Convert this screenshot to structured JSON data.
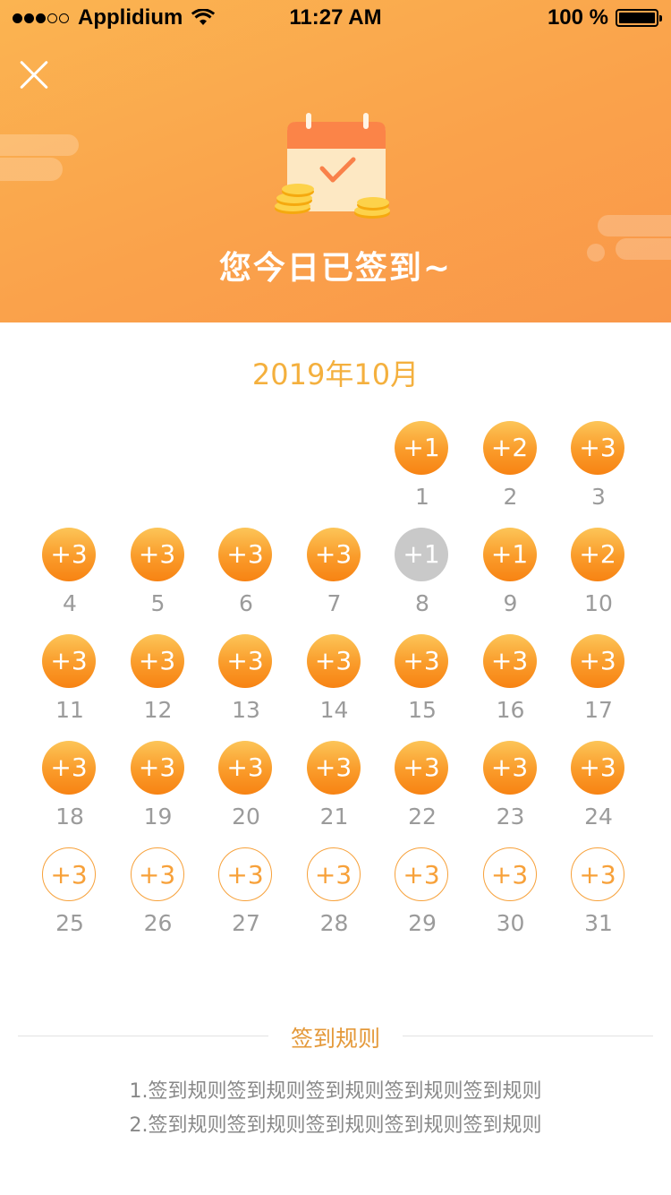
{
  "status_bar": {
    "carrier": "Applidium",
    "time": "11:27 AM",
    "battery": "100 %"
  },
  "header": {
    "title": "您今日已签到~"
  },
  "calendar": {
    "month": "2019年10月",
    "offset": 4,
    "days": [
      {
        "day": "1",
        "reward": "+1",
        "state": "signed"
      },
      {
        "day": "2",
        "reward": "+2",
        "state": "signed"
      },
      {
        "day": "3",
        "reward": "+3",
        "state": "signed"
      },
      {
        "day": "4",
        "reward": "+3",
        "state": "signed"
      },
      {
        "day": "5",
        "reward": "+3",
        "state": "signed"
      },
      {
        "day": "6",
        "reward": "+3",
        "state": "signed"
      },
      {
        "day": "7",
        "reward": "+3",
        "state": "signed"
      },
      {
        "day": "8",
        "reward": "+1",
        "state": "missed"
      },
      {
        "day": "9",
        "reward": "+1",
        "state": "signed"
      },
      {
        "day": "10",
        "reward": "+2",
        "state": "signed"
      },
      {
        "day": "11",
        "reward": "+3",
        "state": "signed"
      },
      {
        "day": "12",
        "reward": "+3",
        "state": "signed"
      },
      {
        "day": "13",
        "reward": "+3",
        "state": "signed"
      },
      {
        "day": "14",
        "reward": "+3",
        "state": "signed"
      },
      {
        "day": "15",
        "reward": "+3",
        "state": "signed"
      },
      {
        "day": "16",
        "reward": "+3",
        "state": "signed"
      },
      {
        "day": "17",
        "reward": "+3",
        "state": "signed"
      },
      {
        "day": "18",
        "reward": "+3",
        "state": "signed"
      },
      {
        "day": "19",
        "reward": "+3",
        "state": "signed"
      },
      {
        "day": "20",
        "reward": "+3",
        "state": "signed"
      },
      {
        "day": "21",
        "reward": "+3",
        "state": "signed"
      },
      {
        "day": "22",
        "reward": "+3",
        "state": "signed"
      },
      {
        "day": "23",
        "reward": "+3",
        "state": "signed"
      },
      {
        "day": "24",
        "reward": "+3",
        "state": "signed"
      },
      {
        "day": "25",
        "reward": "+3",
        "state": "upcoming"
      },
      {
        "day": "26",
        "reward": "+3",
        "state": "upcoming"
      },
      {
        "day": "27",
        "reward": "+3",
        "state": "upcoming"
      },
      {
        "day": "28",
        "reward": "+3",
        "state": "upcoming"
      },
      {
        "day": "29",
        "reward": "+3",
        "state": "upcoming"
      },
      {
        "day": "30",
        "reward": "+3",
        "state": "upcoming"
      },
      {
        "day": "31",
        "reward": "+3",
        "state": "upcoming"
      }
    ]
  },
  "rules": {
    "title": "签到规则",
    "lines": [
      "1.签到规则签到规则签到规则签到规则签到规则",
      "2.签到规则签到规则签到规则签到规则签到规则"
    ]
  },
  "colors": {
    "header_top": "#fbb451",
    "header_bottom": "#f9974a",
    "accent": "#f4b03e",
    "coin_dark": "#f78313",
    "missed": "#c9c9c9"
  },
  "icons": {
    "close": "close-icon",
    "calendar": "calendar-check-icon",
    "coins": "coin-stack-icon",
    "wifi": "wifi-icon",
    "battery": "battery-icon"
  }
}
